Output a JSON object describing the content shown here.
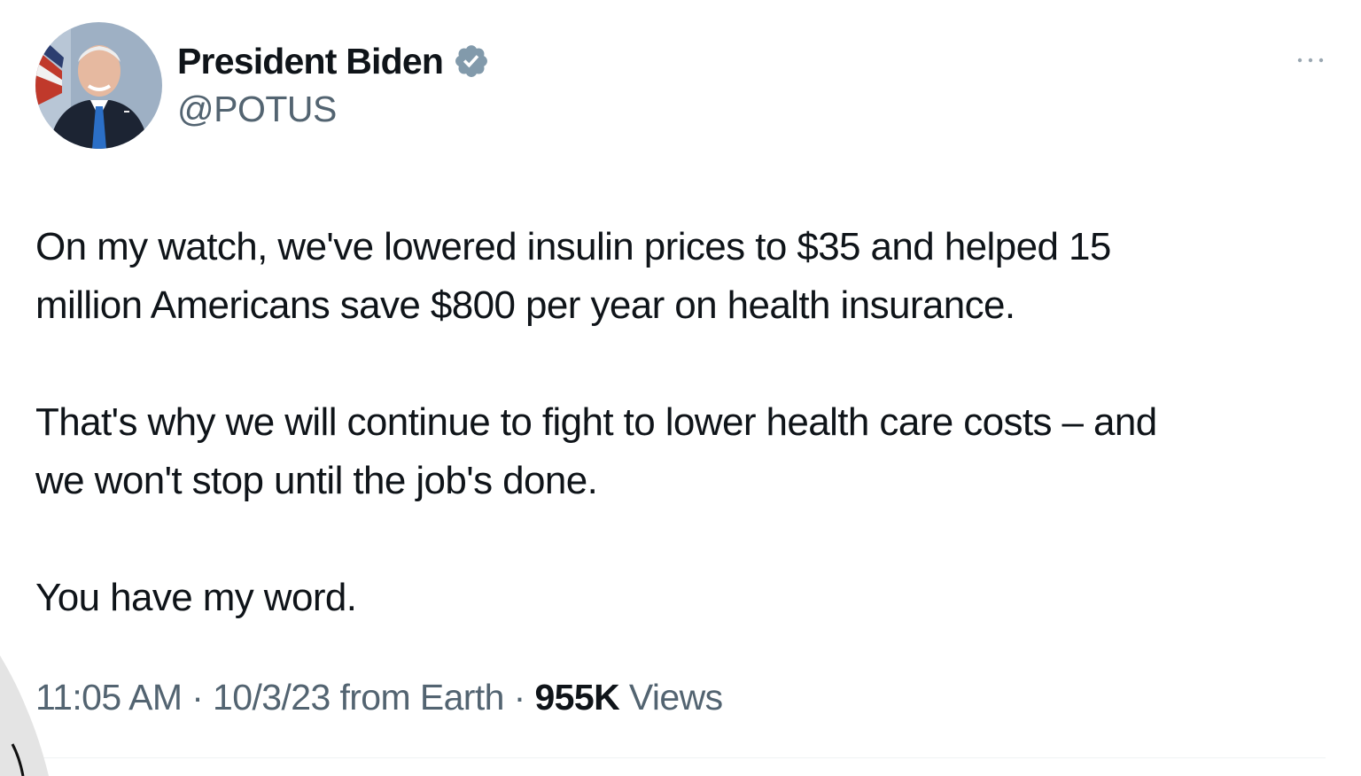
{
  "tweet": {
    "author": {
      "display_name": "President Biden",
      "handle": "@POTUS",
      "verified_icon": "verified-badge-icon",
      "avatar_icon": "profile-photo"
    },
    "more_icon": "more-options-icon",
    "paragraphs": [
      "On my watch, we've lowered insulin prices to $35 and helped 15\nmillion Americans save $800 per year on health insurance.",
      "That's why we will continue to fight to lower health care costs – and\nwe won't stop until the job's done.",
      "You have my word."
    ],
    "time": "11:05 AM",
    "separator": "·",
    "date": "10/3/23",
    "source": "from Earth",
    "views_count": "955K",
    "views_label": "Views"
  },
  "colors": {
    "text_primary": "#0f1419",
    "text_secondary": "#536471",
    "verified_badge": "#829aab",
    "divider": "#eff3f4"
  }
}
